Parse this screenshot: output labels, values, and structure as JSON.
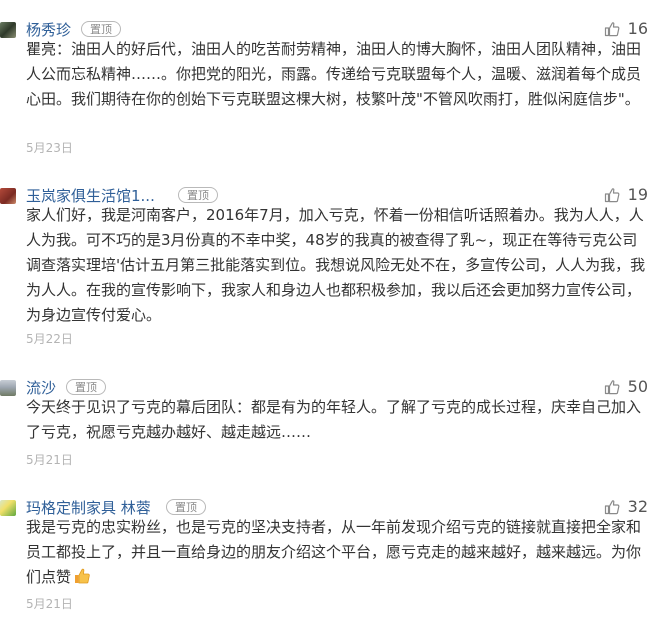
{
  "comments": [
    {
      "name": "杨秀珍",
      "badge": "置顶",
      "likes": "16",
      "text": "瞿亮：油田人的好后代，油田人的吃苦耐劳精神，油田人的博大胸怀，油田人团队精神，油田人公而忘私精神……。你把党的阳光，雨露。传递给亏克联盟每个人，温暖、滋润着每个成员心田。我们期待在你的创始下亏克联盟这棵大树，枝繁叶茂\"不管风吹雨打，胜似闲庭信步\"。",
      "date": "5月23日"
    },
    {
      "name": "玉岚家俱生活馆1...",
      "badge": "置顶",
      "likes": "19",
      "text": "家人们好，我是河南客户，2016年7月，加入亏克，怀着一份相信听话照着办。我为人人，人人为我。可不巧的是3月份真的不幸中奖，48岁的我真的被查得了乳~，现正在等待亏克公司调查落实理培'估计五月第三批能落实到位。我想说风险无处不在，多宣传公司，人人为我，我为人人。在我的宣传影响下，我家人和身边人也都积极参加，我以后还会更加努力宣传公司，为身边宣传付爱心。",
      "date": "5月22日"
    },
    {
      "name": "流沙",
      "badge": "置顶",
      "likes": "50",
      "text": "今天终于见识了亏克的幕后团队：都是有为的年轻人。了解了亏克的成长过程，庆幸自己加入了亏克，祝愿亏克越办越好、越走越远……",
      "date": "5月21日"
    },
    {
      "name": "玛格定制家具 林蓉",
      "badge": "置顶",
      "likes": "32",
      "text": "我是亏克的忠实粉丝，也是亏克的坚决支持者，从一年前发现介绍亏克的链接就直接把全家和员工都投上了，并且一直给身边的朋友介绍这个平台，愿亏克走的越来越好，越来越远。为你们点赞",
      "emoji": "thumbs-up-emoji",
      "date": "5月21日"
    }
  ]
}
